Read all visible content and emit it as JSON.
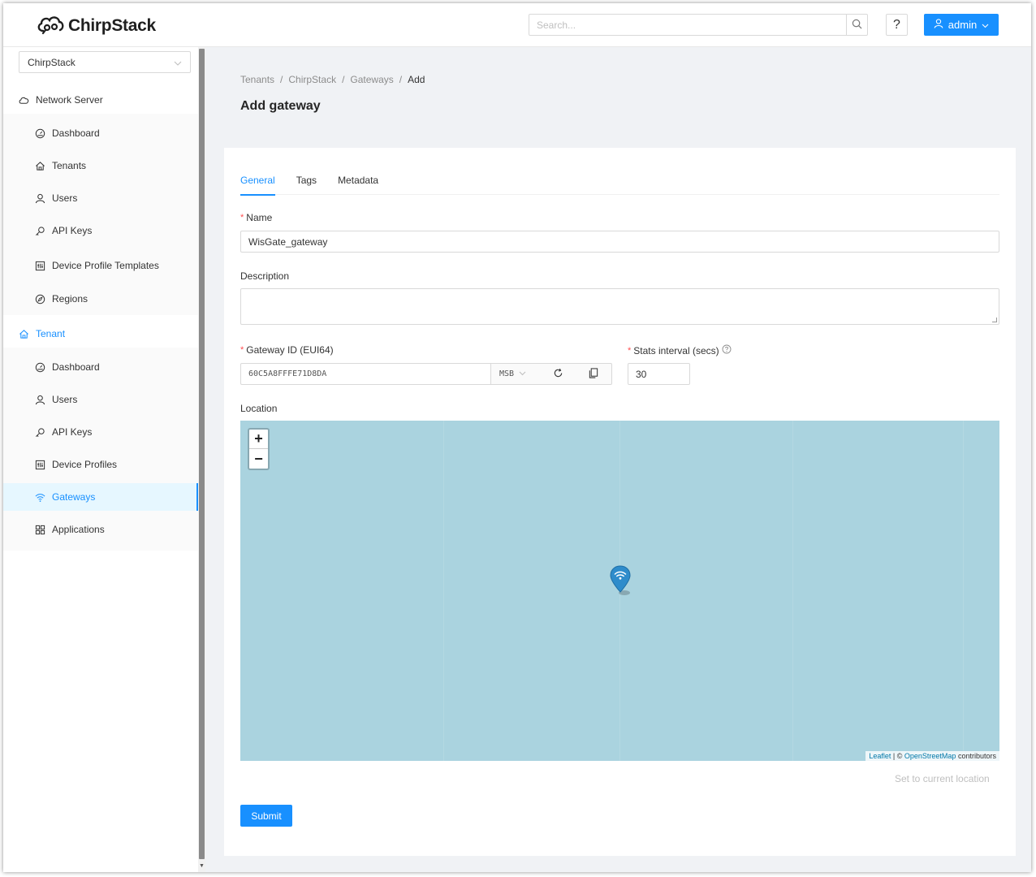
{
  "app": {
    "name": "ChirpStack"
  },
  "header": {
    "search_placeholder": "Search...",
    "help_label": "?",
    "user_label": "admin"
  },
  "sidebar": {
    "tenant_select": "ChirpStack",
    "network_server": {
      "label": "Network Server",
      "items": [
        {
          "label": "Dashboard",
          "icon": "dashboard-icon"
        },
        {
          "label": "Tenants",
          "icon": "home-icon"
        },
        {
          "label": "Users",
          "icon": "user-icon"
        },
        {
          "label": "API Keys",
          "icon": "key-icon"
        },
        {
          "label": "Device Profile Templates",
          "icon": "control-icon"
        },
        {
          "label": "Regions",
          "icon": "compass-icon"
        }
      ]
    },
    "tenant": {
      "label": "Tenant",
      "items": [
        {
          "label": "Dashboard",
          "icon": "dashboard-icon"
        },
        {
          "label": "Users",
          "icon": "user-icon"
        },
        {
          "label": "API Keys",
          "icon": "key-icon"
        },
        {
          "label": "Device Profiles",
          "icon": "control-icon"
        },
        {
          "label": "Gateways",
          "icon": "wifi-icon",
          "selected": true
        },
        {
          "label": "Applications",
          "icon": "appstore-icon"
        }
      ]
    }
  },
  "breadcrumb": [
    "Tenants",
    "ChirpStack",
    "Gateways",
    "Add"
  ],
  "page_title": "Add gateway",
  "tabs": [
    {
      "label": "General",
      "active": true
    },
    {
      "label": "Tags"
    },
    {
      "label": "Metadata"
    }
  ],
  "form": {
    "name": {
      "label": "Name",
      "value": "WisGate_gateway"
    },
    "description": {
      "label": "Description",
      "value": ""
    },
    "gateway_id": {
      "label": "Gateway ID (EUI64)",
      "value": "60C5A8FFFE71D8DA",
      "byte_order": "MSB"
    },
    "stats_interval": {
      "label": "Stats interval (secs)",
      "value": "30"
    },
    "location": {
      "label": "Location"
    },
    "set_location_label": "Set to current location",
    "submit_label": "Submit"
  },
  "map": {
    "water_color": "#aad3df",
    "attribution_leaflet": "Leaflet",
    "attribution_sep": "| ©",
    "attribution_osm": "OpenStreetMap",
    "attribution_suffix": "contributors"
  },
  "colors": {
    "primary": "#1890ff",
    "required": "#ff4d4f"
  }
}
